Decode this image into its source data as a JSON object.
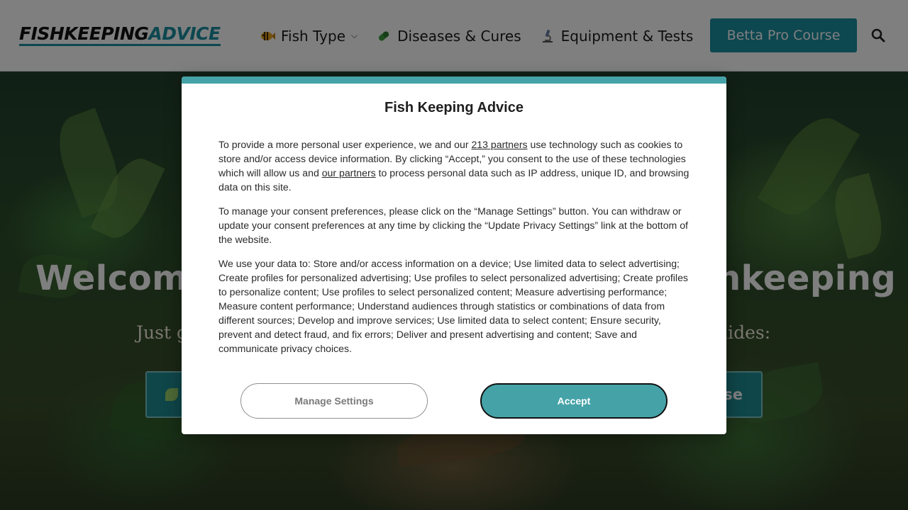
{
  "header": {
    "logo_part1": "Fishkeeping",
    "logo_part2": "Advice",
    "nav": [
      {
        "label": "Fish Type",
        "icon": "fish-icon",
        "has_dropdown": true
      },
      {
        "label": "Diseases & Cures",
        "icon": "pill-icon",
        "has_dropdown": false
      },
      {
        "label": "Equipment & Tests",
        "icon": "microscope-icon",
        "has_dropdown": false
      }
    ],
    "cta_label": "Betta Pro Course",
    "search_icon": "search-icon",
    "accent_color": "#1a8fa0"
  },
  "hero": {
    "title_left": "Welcome",
    "title_right": "hkeeping",
    "subtitle_left": "Just g",
    "subtitle_right": "uides:",
    "button_right": "se"
  },
  "consent": {
    "title": "Fish Keeping Advice",
    "p1_a": "To provide a more personal user experience, we and our ",
    "p1_link1": "213 partners",
    "p1_b": " use technology such as cookies to store and/or access device information. By clicking “Accept,” you consent to the use of these technologies which will allow us and ",
    "p1_link2": "our partners",
    "p1_c": " to process personal data such as IP address, unique ID, and browsing data on this site.",
    "p2": "To manage your consent preferences, please click on the “Manage Settings” button. You can withdraw or update your consent preferences at any time by clicking the “Update Privacy Settings” link at the bottom of the website.",
    "p3": "We use your data to: Store and/or access information on a device; Use limited data to select advertising; Create profiles for personalized advertising; Use profiles to select personalized advertising; Create profiles to personalize content; Use profiles to select personalized content; Measure advertising performance; Measure content performance; Understand audiences through statistics or combinations of data from different sources; Develop and improve services; Use limited data to select content; Ensure security, prevent and detect fraud, and fix errors; Deliver and present advertising and content; Save and communicate privacy choices.",
    "manage_label": "Manage Settings",
    "accept_label": "Accept",
    "accent_color": "#45a3a8"
  }
}
